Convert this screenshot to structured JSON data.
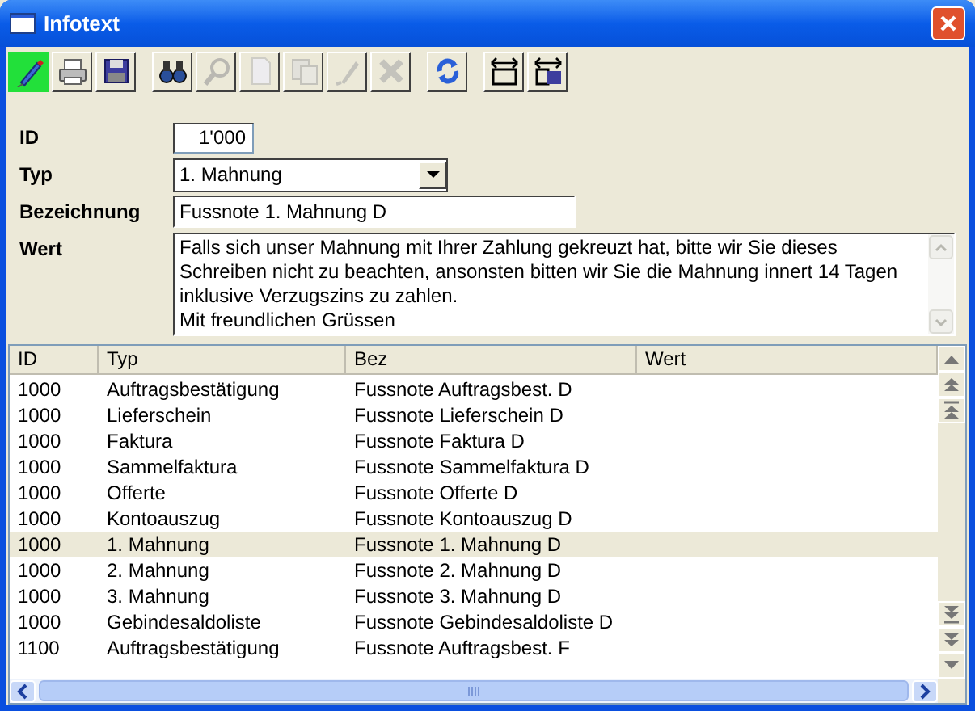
{
  "window": {
    "title": "Infotext"
  },
  "toolbar": [
    [
      {
        "kind": "edit",
        "selected": true,
        "disabled": false
      },
      {
        "kind": "print",
        "selected": false,
        "disabled": false
      },
      {
        "kind": "save",
        "selected": false,
        "disabled": false
      }
    ],
    [
      {
        "kind": "find",
        "selected": false,
        "disabled": false
      },
      {
        "kind": "zoom",
        "selected": false,
        "disabled": true
      },
      {
        "kind": "new",
        "selected": false,
        "disabled": true
      },
      {
        "kind": "copy",
        "selected": false,
        "disabled": true
      },
      {
        "kind": "pen",
        "selected": false,
        "disabled": true
      },
      {
        "kind": "delete",
        "selected": false,
        "disabled": true
      }
    ],
    [
      {
        "kind": "refresh",
        "selected": false,
        "disabled": false
      }
    ],
    [
      {
        "kind": "width",
        "selected": false,
        "disabled": false
      },
      {
        "kind": "width-save",
        "selected": false,
        "disabled": false
      }
    ]
  ],
  "form": {
    "id": {
      "label": "ID",
      "value": "1'000"
    },
    "typ": {
      "label": "Typ",
      "value": "1. Mahnung"
    },
    "bezeichnung": {
      "label": "Bezeichnung",
      "value": "Fussnote 1. Mahnung D"
    },
    "wert": {
      "label": "Wert",
      "value": "Falls sich unser Mahnung mit Ihrer Zahlung gekreuzt hat, bitte wir Sie dieses Schreiben nicht zu beachten, ansonsten bitten wir Sie die Mahnung innert 14 Tagen inklusive Verzugszins zu zahlen.\nMit freundlichen Grüssen"
    }
  },
  "table": {
    "columns": [
      "ID",
      "Typ",
      "Bez",
      "Wert"
    ],
    "rows": [
      {
        "cells": [
          "1000",
          "Auftragsbestätigung",
          "Fussnote Auftragsbest. D"
        ],
        "selected": false
      },
      {
        "cells": [
          "1000",
          "Lieferschein",
          "Fussnote Lieferschein D"
        ],
        "selected": false
      },
      {
        "cells": [
          "1000",
          "Faktura",
          "Fussnote Faktura D"
        ],
        "selected": false
      },
      {
        "cells": [
          "1000",
          "Sammelfaktura",
          "Fussnote Sammelfaktura D"
        ],
        "selected": false
      },
      {
        "cells": [
          "1000",
          "Offerte",
          "Fussnote Offerte D"
        ],
        "selected": false
      },
      {
        "cells": [
          "1000",
          "Kontoauszug",
          "Fussnote Kontoauszug D"
        ],
        "selected": false
      },
      {
        "cells": [
          "1000",
          "1. Mahnung",
          "Fussnote 1. Mahnung D"
        ],
        "selected": true
      },
      {
        "cells": [
          "1000",
          "2. Mahnung",
          "Fussnote 2. Mahnung D"
        ],
        "selected": false
      },
      {
        "cells": [
          "1000",
          "3. Mahnung",
          "Fussnote 3. Mahnung D"
        ],
        "selected": false
      },
      {
        "cells": [
          "1000",
          "Gebindesaldoliste",
          "Fussnote Gebindesaldoliste D"
        ],
        "selected": false
      },
      {
        "cells": [
          "1100",
          "Auftragsbestätigung",
          "Fussnote Auftragsbest. F"
        ],
        "selected": false
      }
    ]
  }
}
